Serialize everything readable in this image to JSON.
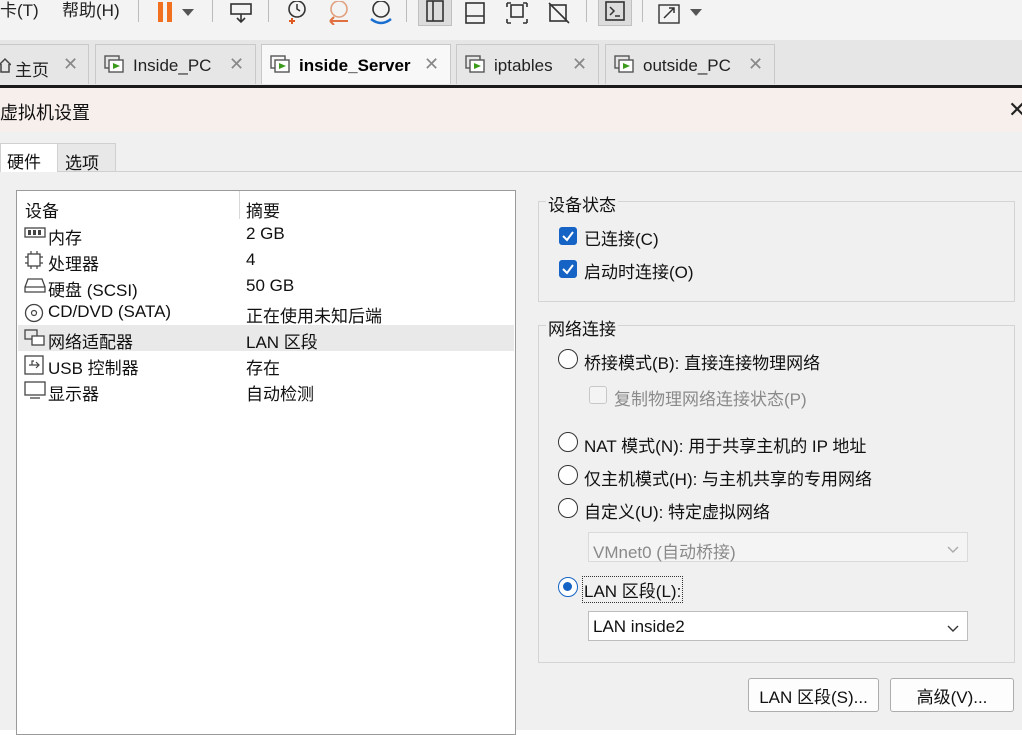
{
  "menubar": {
    "items": [
      "卡(T)",
      "帮助(H)"
    ]
  },
  "toolbar": {
    "icons": [
      "pause-icon",
      "dropdown-arrow-icon",
      "send-keys-icon",
      "snapshot-take-icon",
      "snapshot-revert-icon",
      "snapshot-manager-icon",
      "library-view-icon",
      "thumbnail-bar-icon",
      "fit-guest-icon",
      "unity-icon",
      "console-icon",
      "fullscreen-icon",
      "dropdown-arrow-icon"
    ]
  },
  "tabs": [
    {
      "label": "主页",
      "icon": "home-icon",
      "active": false
    },
    {
      "label": "Inside_PC",
      "icon": "vm-running-icon",
      "active": false
    },
    {
      "label": "inside_Server",
      "icon": "vm-running-icon",
      "active": true
    },
    {
      "label": "iptables",
      "icon": "vm-running-icon",
      "active": false
    },
    {
      "label": "outside_PC",
      "icon": "vm-running-icon",
      "active": false
    }
  ],
  "dialog": {
    "title": "虚拟机设置",
    "close_glyph": "✕",
    "subtabs": [
      "硬件",
      "选项"
    ]
  },
  "devices": {
    "headers": {
      "device": "设备",
      "summary": "摘要"
    },
    "rows": [
      {
        "name": "内存",
        "summary": "2 GB",
        "icon": "memory-icon"
      },
      {
        "name": "处理器",
        "summary": "4",
        "icon": "processor-icon"
      },
      {
        "name": "硬盘 (SCSI)",
        "summary": "50 GB",
        "icon": "hard-disk-icon"
      },
      {
        "name": "CD/DVD (SATA)",
        "summary": "正在使用未知后端",
        "icon": "cd-dvd-icon"
      },
      {
        "name": "网络适配器",
        "summary": "LAN 区段",
        "icon": "network-adapter-icon",
        "selected": true
      },
      {
        "name": "USB 控制器",
        "summary": "存在",
        "icon": "usb-icon"
      },
      {
        "name": "显示器",
        "summary": "自动检测",
        "icon": "display-icon"
      }
    ]
  },
  "device_status": {
    "title": "设备状态",
    "connected": {
      "label": "已连接(C)",
      "checked": true
    },
    "connect_at_power_on": {
      "label": "启动时连接(O)",
      "checked": true
    }
  },
  "network": {
    "title": "网络连接",
    "bridged": {
      "label": "桥接模式(B): 直接连接物理网络",
      "selected": false
    },
    "replicate": {
      "label": "复制物理网络连接状态(P)",
      "checked": false,
      "enabled": false
    },
    "nat": {
      "label": "NAT 模式(N): 用于共享主机的 IP 地址",
      "selected": false
    },
    "host_only": {
      "label": "仅主机模式(H): 与主机共享的专用网络",
      "selected": false
    },
    "custom": {
      "label": "自定义(U): 特定虚拟网络",
      "selected": false
    },
    "custom_select": {
      "value": "VMnet0 (自动桥接)",
      "enabled": false
    },
    "lan_segment": {
      "label": "LAN 区段(L):",
      "selected": true
    },
    "lan_select": {
      "value": "LAN inside2"
    }
  },
  "buttons": {
    "lan_segments": "LAN 区段(S)...",
    "advanced": "高级(V)..."
  }
}
